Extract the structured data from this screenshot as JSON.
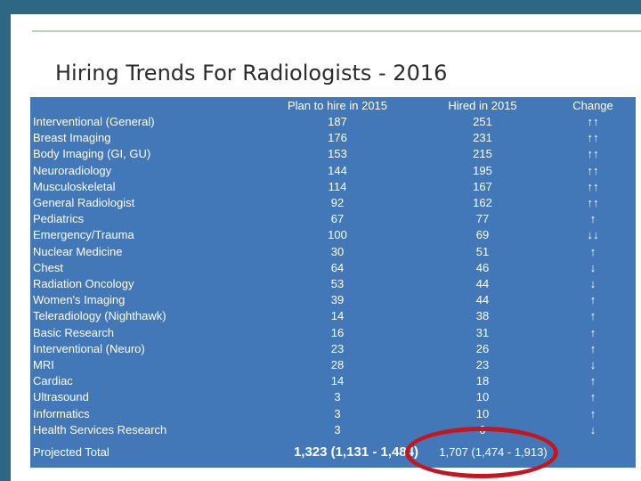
{
  "slide": {
    "title": "Hiring Trends For Radiologists - 2016"
  },
  "table": {
    "headers": [
      "",
      "Plan to hire in 2015",
      "Hired in 2015",
      "Change"
    ],
    "rows": [
      [
        "Interventional (General)",
        "187",
        "251",
        "↑↑"
      ],
      [
        "Breast Imaging",
        "176",
        "231",
        "↑↑"
      ],
      [
        "Body Imaging (GI, GU)",
        "153",
        "215",
        "↑↑"
      ],
      [
        "Neuroradiology",
        "144",
        "195",
        "↑↑"
      ],
      [
        "Musculoskeletal",
        "114",
        "167",
        "↑↑"
      ],
      [
        "General Radiologist",
        "92",
        "162",
        "↑↑"
      ],
      [
        "Pediatrics",
        "67",
        "77",
        "↑"
      ],
      [
        "Emergency/Trauma",
        "100",
        "69",
        "↓↓"
      ],
      [
        "Nuclear Medicine",
        "30",
        "51",
        "↑"
      ],
      [
        "Chest",
        "64",
        "46",
        "↓"
      ],
      [
        "Radiation Oncology",
        "53",
        "44",
        "↓"
      ],
      [
        "Women's Imaging",
        "39",
        "44",
        "↑"
      ],
      [
        "Teleradiology (Nighthawk)",
        "14",
        "38",
        "↑"
      ],
      [
        "Basic Research",
        "16",
        "31",
        "↑"
      ],
      [
        "Interventional (Neuro)",
        "23",
        "26",
        "↑"
      ],
      [
        "MRI",
        "28",
        "23",
        "↓"
      ],
      [
        "Cardiac",
        "14",
        "18",
        "↑"
      ],
      [
        "Ultrasound",
        "3",
        "10",
        "↑"
      ],
      [
        "Informatics",
        "3",
        "10",
        "↑"
      ],
      [
        "Health Services Research",
        "3",
        "0",
        "↓"
      ]
    ],
    "total": [
      "Projected Total",
      "1,323  (1,131 - 1,484)",
      "1,707 (1,474 - 1,913)",
      ""
    ]
  },
  "colors": {
    "frame": "#2e6784",
    "table_background": "#4277b8",
    "highlight": "#c4161c"
  }
}
